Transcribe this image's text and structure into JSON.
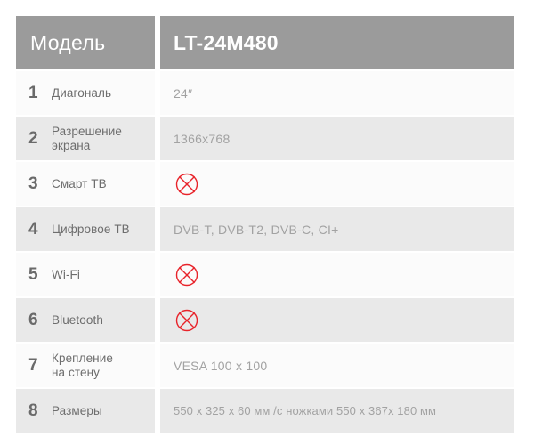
{
  "header": {
    "label": "Модель",
    "model": "LT-24M480",
    "bg_color": "#9b9b9b",
    "text_color": "#ffffff"
  },
  "colors": {
    "row_light": "#fbfbfb",
    "row_dark": "#e9e9e9",
    "number": "#6a6a6a",
    "label": "#6d6d6d",
    "value": "#a2a2a2",
    "cross": "#e8232a"
  },
  "rows": [
    {
      "num": "1",
      "label": "Диагональ",
      "value": "24″",
      "icon": null
    },
    {
      "num": "2",
      "label": "Разрешение\nэкрана",
      "value": "1366x768",
      "icon": null
    },
    {
      "num": "3",
      "label": "Смарт ТВ",
      "value": "",
      "icon": "circle-cross-icon"
    },
    {
      "num": "4",
      "label": "Цифровое ТВ",
      "value": "DVB-T, DVB-T2, DVB-C, CI+",
      "icon": null
    },
    {
      "num": "5",
      "label": "Wi-Fi",
      "value": "",
      "icon": "circle-cross-icon"
    },
    {
      "num": "6",
      "label": "Bluetooth",
      "value": "",
      "icon": "circle-cross-icon"
    },
    {
      "num": "7",
      "label": "Крепление\nна стену",
      "value": "VESA 100 x  100",
      "icon": null
    },
    {
      "num": "8",
      "label": "Размеры",
      "value": "550 x 325 x 60 мм  /с ножками 550 x 367x 180 мм",
      "icon": null
    }
  ]
}
